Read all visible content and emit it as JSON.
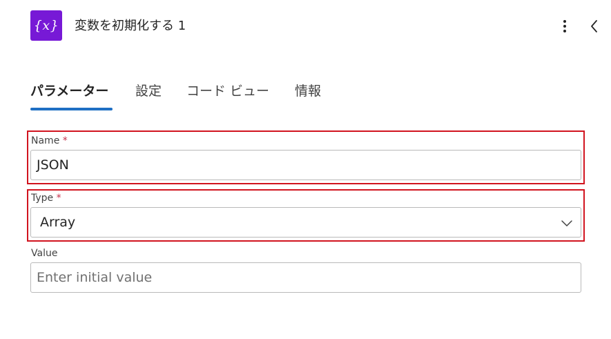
{
  "header": {
    "icon_text": "{x}",
    "icon": "variable-braces-icon",
    "title": "変数を初期化する 1",
    "more_icon": "more-vertical-icon",
    "collapse_icon": "chevron-left-icon"
  },
  "tabs": [
    {
      "label": "パラメーター",
      "active": true
    },
    {
      "label": "設定",
      "active": false
    },
    {
      "label": "コード ビュー",
      "active": false
    },
    {
      "label": "情報",
      "active": false
    }
  ],
  "fields": {
    "name": {
      "label": "Name",
      "required_mark": "*",
      "value": "JSON"
    },
    "type": {
      "label": "Type",
      "required_mark": "*",
      "value": "Array",
      "icon": "chevron-down-icon"
    },
    "value": {
      "label": "Value",
      "placeholder": "Enter initial value"
    }
  },
  "colors": {
    "icon_background": "#7719d6",
    "tab_indicator": "#1f6fc4",
    "highlight_border": "#d1131e",
    "required_mark": "#c4314b"
  }
}
